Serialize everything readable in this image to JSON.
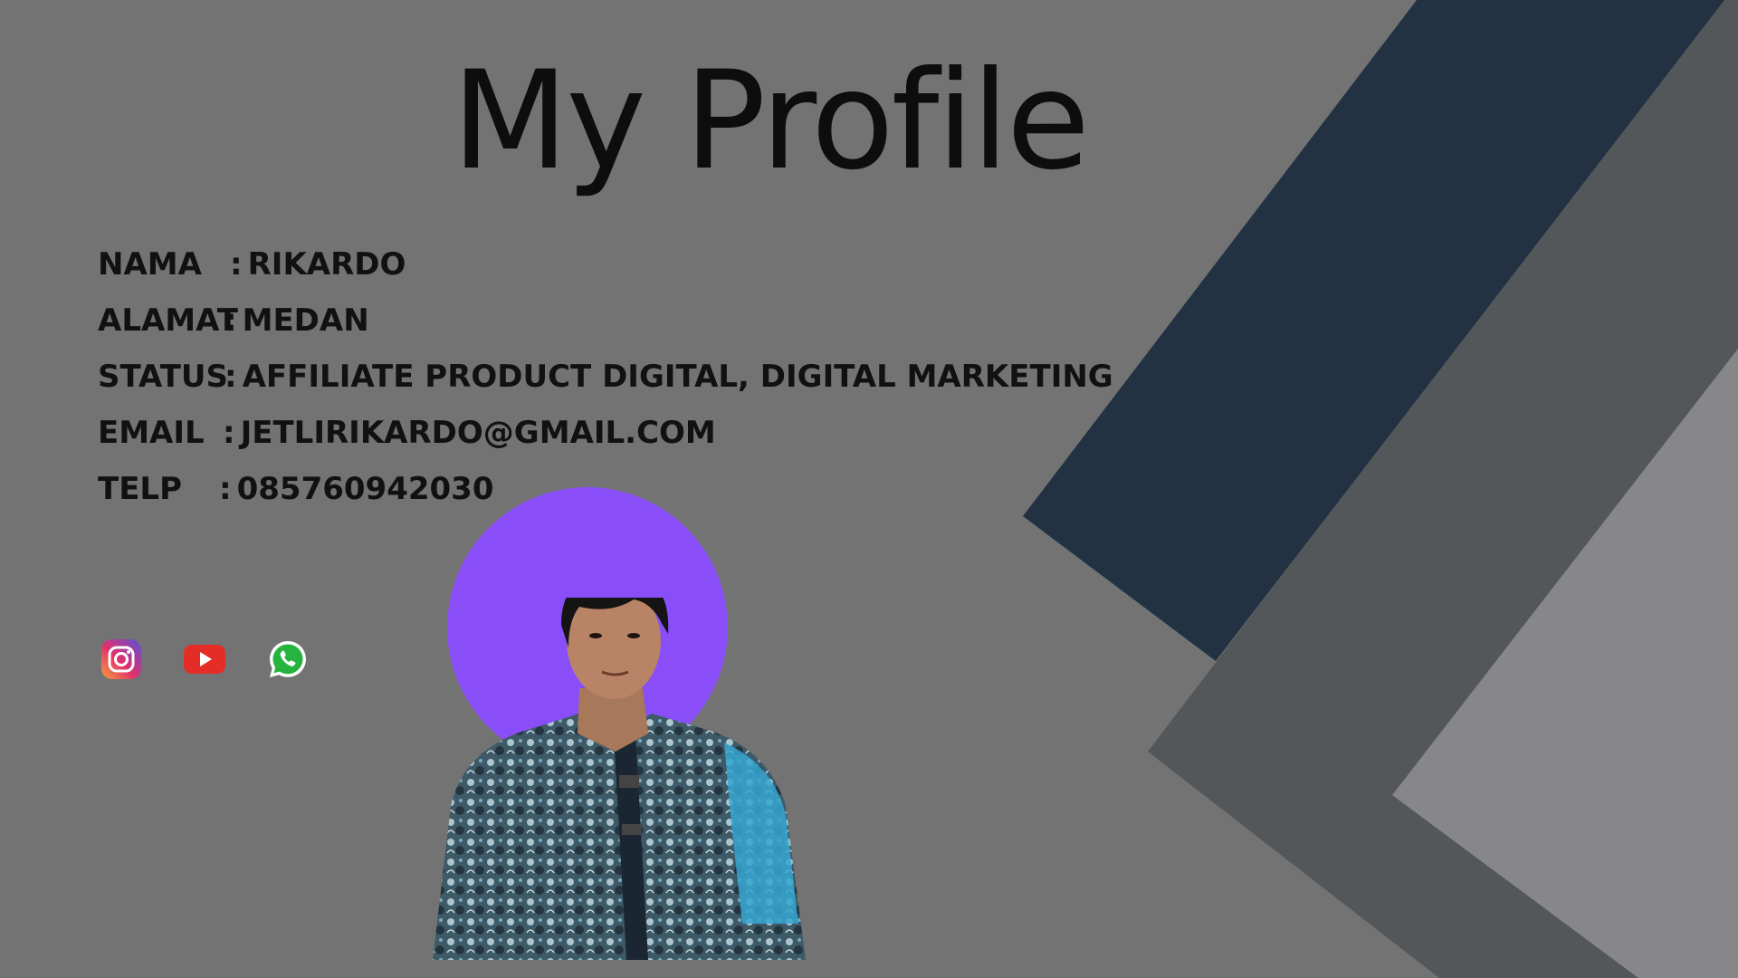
{
  "title": "My Profile",
  "profile": {
    "nama": {
      "label": "NAMA",
      "sep": ":",
      "value": "RIKARDO"
    },
    "alamat": {
      "label": "ALAMAT",
      "sep": ":",
      "value": "MEDAN"
    },
    "status": {
      "label": "STATUS",
      "sep": ":",
      "value": "AFFILIATE PRODUCT DIGITAL,  DIGITAL MARKETING"
    },
    "email": {
      "label": "EMAIL",
      "sep": ":",
      "value": "JETLIRIKARDO@GMAIL.COM"
    },
    "telp": {
      "label": "TELP",
      "sep": ":",
      "value": "085760942030"
    }
  },
  "socials": [
    {
      "icon": "instagram-icon"
    },
    {
      "icon": "youtube-icon"
    },
    {
      "icon": "whatsapp-icon"
    }
  ],
  "colors": {
    "background": "#737373",
    "navy_band": "#223243",
    "dark_gray_band": "#53575a",
    "light_gray_band": "#87878a",
    "halo": "#8a4cff",
    "text": "#111111"
  }
}
